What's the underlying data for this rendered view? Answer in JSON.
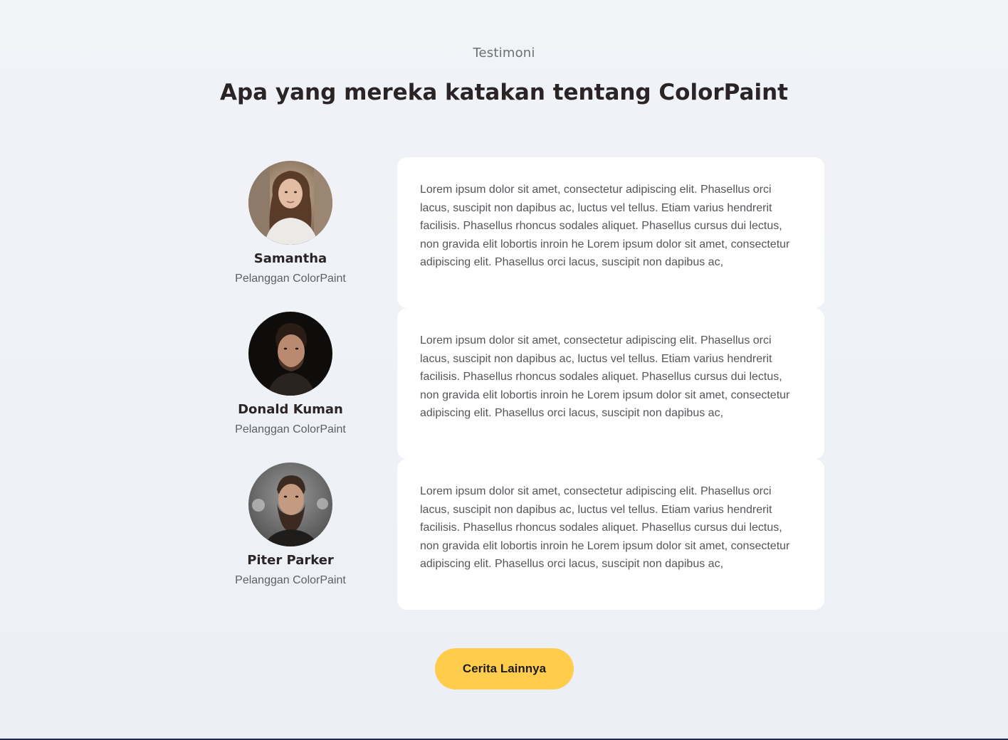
{
  "section": {
    "eyebrow": "Testimoni",
    "heading": "Apa yang mereka katakan tentang ColorPaint"
  },
  "testimonials": [
    {
      "name": "Samantha",
      "role": "Pelanggan ColorPaint",
      "avatar": "woman-portrait-photo",
      "text": "Lorem ipsum dolor sit amet, consectetur adipiscing elit. Phasellus orci lacus, suscipit non dapibus ac, luctus vel tellus. Etiam varius hendrerit facilisis. Phasellus rhoncus sodales aliquet. Phasellus cursus dui lectus, non gravida elit lobortis inroin he Lorem ipsum dolor sit amet, consectetur adipiscing elit. Phasellus orci lacus, suscipit non dapibus ac,"
    },
    {
      "name": "Donald Kuman",
      "role": "Pelanggan ColorPaint",
      "avatar": "man-portrait-photo",
      "text": "Lorem ipsum dolor sit amet, consectetur adipiscing elit. Phasellus orci lacus, suscipit non dapibus ac, luctus vel tellus. Etiam varius hendrerit facilisis. Phasellus rhoncus sodales aliquet. Phasellus cursus dui lectus, non gravida elit lobortis inroin he Lorem ipsum dolor sit amet, consectetur adipiscing elit. Phasellus orci lacus, suscipit non dapibus ac,"
    },
    {
      "name": "Piter Parker",
      "role": "Pelanggan ColorPaint",
      "avatar": "bearded-man-portrait-photo",
      "text": "Lorem ipsum dolor sit amet, consectetur adipiscing elit. Phasellus orci lacus, suscipit non dapibus ac, luctus vel tellus. Etiam varius hendrerit facilisis. Phasellus rhoncus sodales aliquet. Phasellus cursus dui lectus, non gravida elit lobortis inroin he Lorem ipsum dolor sit amet, consectetur adipiscing elit. Phasellus orci lacus, suscipit non dapibus ac,"
    }
  ],
  "cta": {
    "label": "Cerita Lainnya"
  },
  "colors": {
    "background": "#eef1f6",
    "card": "#ffffff",
    "accent": "#ffcd4b",
    "heading": "#2b2426",
    "body_text": "#55555a"
  }
}
